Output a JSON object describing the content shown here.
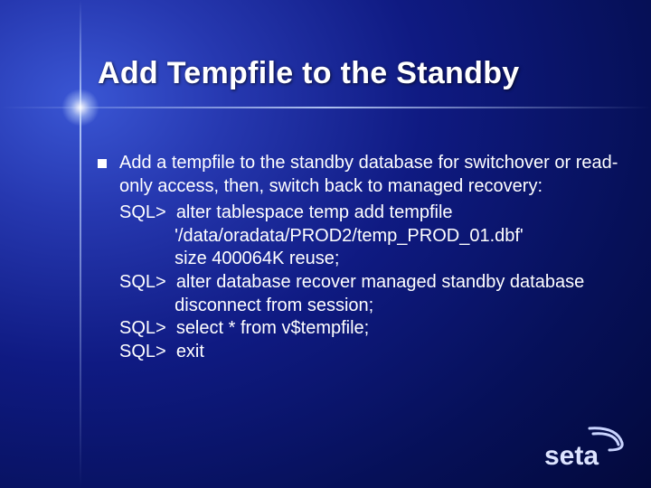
{
  "title": "Add Tempfile to the Standby",
  "bullet": "Add a tempfile to the standby database for switchover or read-only access, then, switch back to managed recovery:",
  "code": "SQL>  alter tablespace temp add tempfile\n           '/data/oradata/PROD2/temp_PROD_01.dbf'\n           size 400064K reuse;\nSQL>  alter database recover managed standby database\n           disconnect from session;\nSQL>  select * from v$tempfile;\nSQL>  exit",
  "logo_text": "seta"
}
